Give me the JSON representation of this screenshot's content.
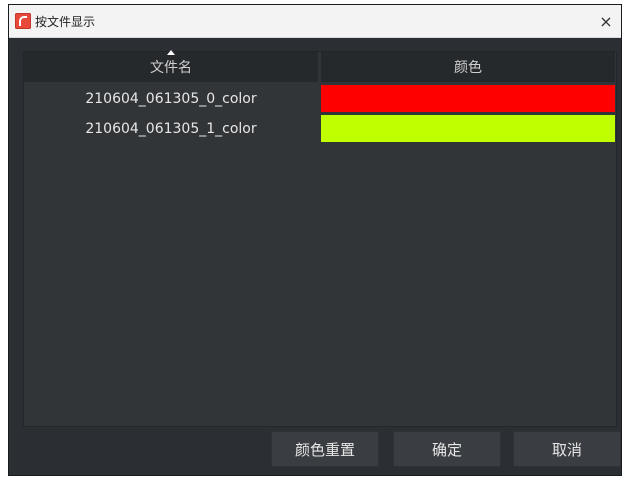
{
  "window": {
    "title": "按文件显示",
    "close_symbol": "×"
  },
  "table": {
    "columns": [
      "文件名",
      "颜色"
    ],
    "rows": [
      {
        "name": "210604_061305_0_color",
        "color": "#ff0000"
      },
      {
        "name": "210604_061305_1_color",
        "color": "#bfff00"
      }
    ]
  },
  "buttons": {
    "reset": "颜色重置",
    "ok": "确定",
    "cancel": "取消"
  }
}
